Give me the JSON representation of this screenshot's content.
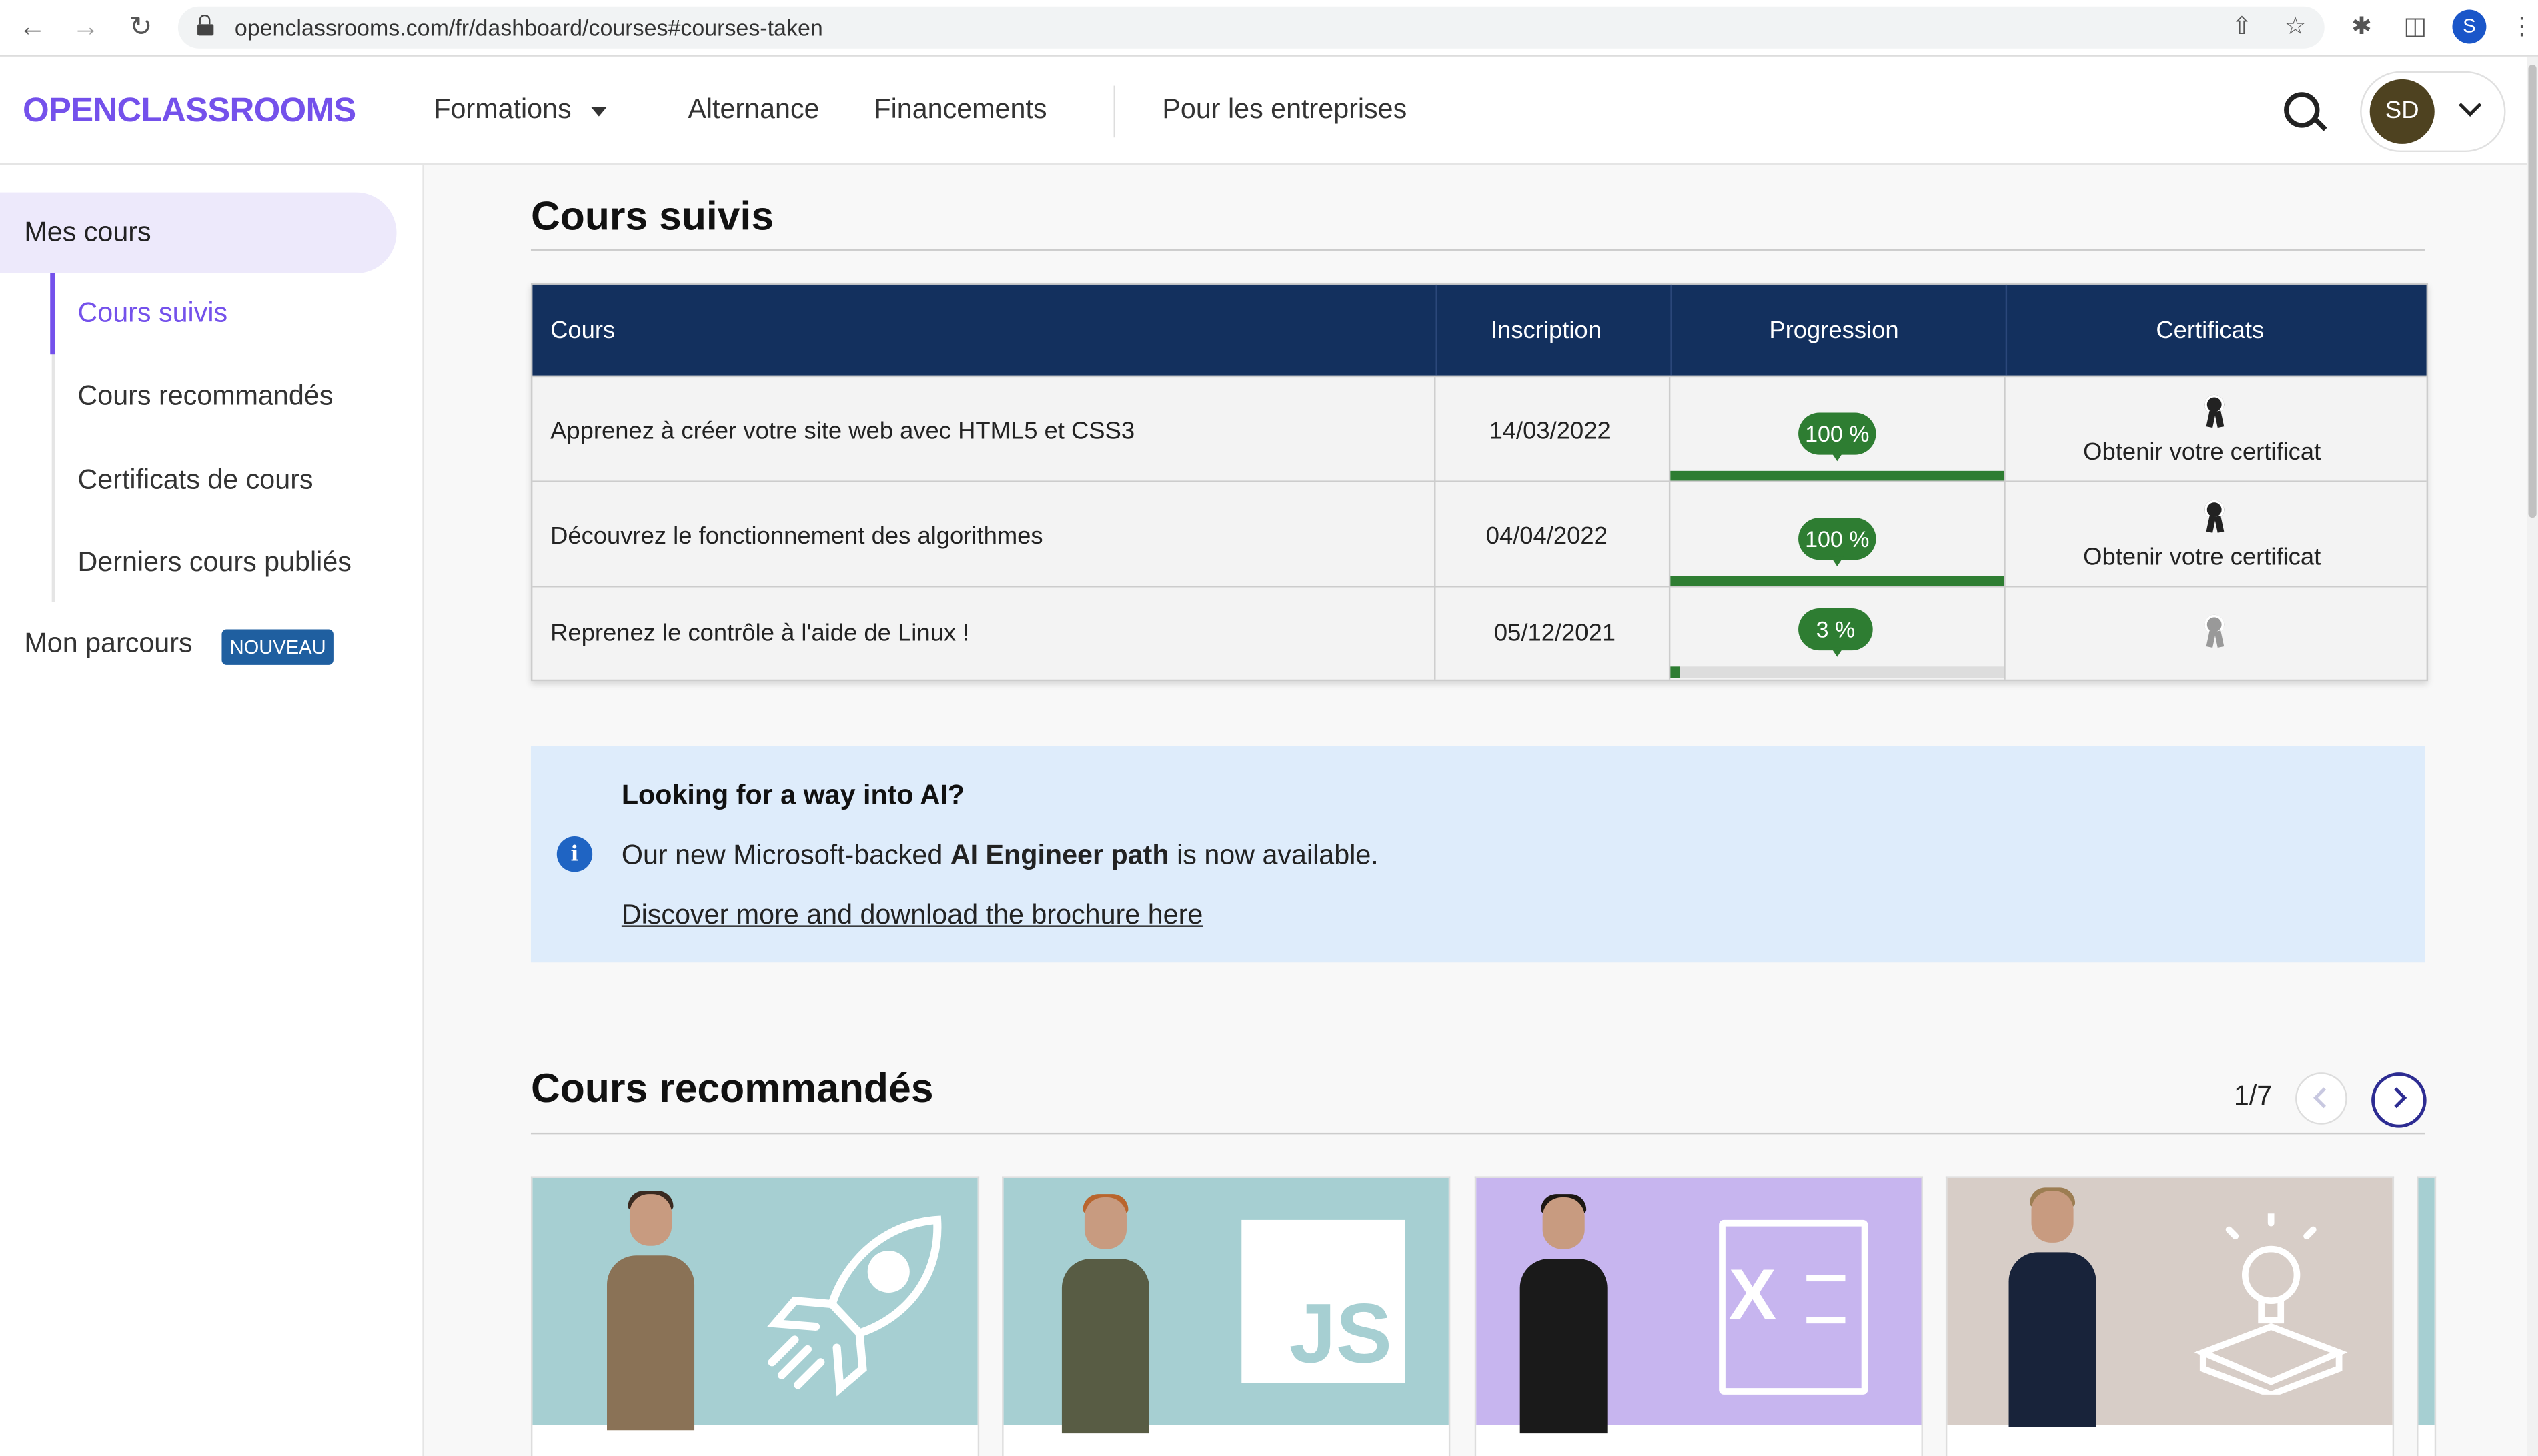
{
  "browser": {
    "url": "openclassrooms.com/fr/dashboard/courses#courses-taken",
    "profile_initial": "S"
  },
  "header": {
    "logo": "OPENCLASSROOMS",
    "nav": [
      "Formations",
      "Alternance",
      "Financements",
      "Pour les entreprises"
    ],
    "avatar_initials": "SD"
  },
  "sidebar": {
    "section": "Mes cours",
    "items": [
      "Cours suivis",
      "Cours recommandés",
      "Certificats de cours",
      "Derniers cours publiés"
    ],
    "parcours": "Mon parcours",
    "badge": "NOUVEAU"
  },
  "courses_taken": {
    "title": "Cours suivis",
    "headers": [
      "Cours",
      "Inscription",
      "Progression",
      "Certificats"
    ],
    "rows": [
      {
        "course": "Apprenez à créer votre site web avec HTML5 et CSS3",
        "date": "14/03/2022",
        "progress": "100 %",
        "progress_value": 1.0,
        "certificate": "Obtenir votre certificat"
      },
      {
        "course": "Découvrez le fonctionnement des algorithmes",
        "date": "04/04/2022",
        "progress": "100 %",
        "progress_value": 1.0,
        "certificate": "Obtenir votre certificat"
      },
      {
        "course": "Reprenez le contrôle à l'aide de Linux !",
        "date": "05/12/2021",
        "progress": "3 %",
        "progress_value": 0.03,
        "certificate": ""
      }
    ]
  },
  "info_box": {
    "title": "Looking for a way into AI?",
    "line_prefix": "Our new Microsoft-backed ",
    "line_bold": "AI Engineer path",
    "line_suffix": " is now available.",
    "link": "Discover more and download the brochure here"
  },
  "recommended": {
    "title": "Cours recommandés",
    "pager": "1/7",
    "cards": [
      {
        "icon": "python-rocket-icon",
        "bg": "#a6cfd2"
      },
      {
        "icon": "javascript-icon",
        "icon_text": "JS",
        "bg": "#a6cfd2"
      },
      {
        "icon": "excel-icon",
        "icon_text": "X",
        "bg": "#c7b5ef"
      },
      {
        "icon": "lightbulb-idea-icon",
        "bg": "#d7cdc7"
      }
    ]
  },
  "colors": {
    "brand": "#7451eb",
    "table_header": "#13305e",
    "progress": "#2e7d32",
    "badge": "#1f5fa0",
    "info_bg": "#deecfb"
  }
}
